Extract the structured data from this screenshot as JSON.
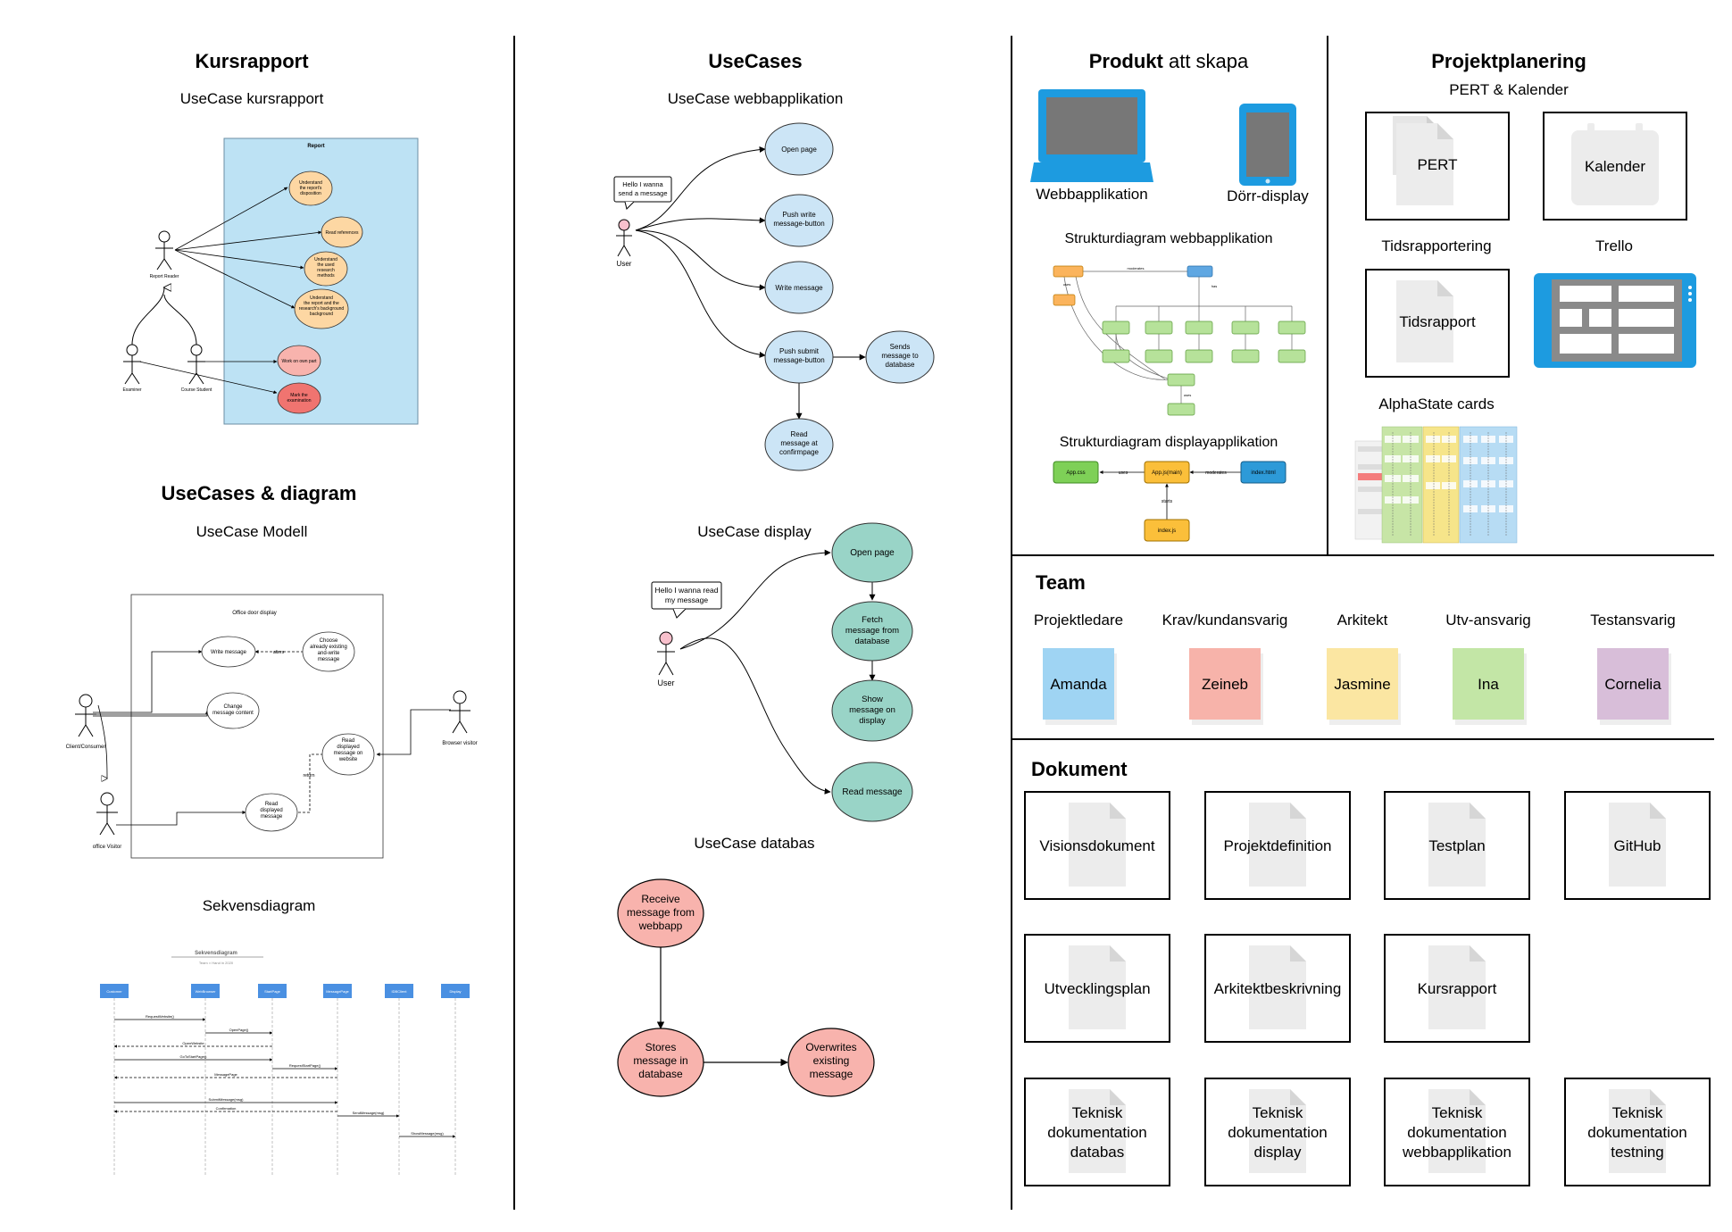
{
  "kursrapport": {
    "title": "Kursrapport",
    "subtitle": "UseCase kursrapport",
    "diagram": {
      "boundary": "Report",
      "actors": [
        "Report Reader",
        "Examiner",
        "Course Student"
      ],
      "use_cases": [
        "Understand the report's disposition",
        "Read references",
        "Understand the used research methods",
        "Understand the report and the research's background background",
        "Work on own part",
        "Mark the examination"
      ]
    }
  },
  "usecases_diagram": {
    "title": "UseCases & diagram",
    "subtitle": "UseCase Modell",
    "diagram": {
      "boundary": "Office door display",
      "actors": [
        "Client/Consumer",
        "office Visitor",
        "Browser visitor"
      ],
      "use_cases": [
        "Write message",
        "Choose already existing message",
        "Change message content",
        "Read displayed message on website",
        "Read displayed message"
      ],
      "labels": [
        "alters",
        "return"
      ]
    }
  },
  "sekvens": {
    "title": "Sekvensdiagram",
    "diagram_title": "Sekvensdiagram",
    "diagram_subtitle": "Team × Hand in 2020",
    "participants": [
      "Customer",
      "WebBrowser",
      "StartPage",
      "MessagePage",
      "IDBClient",
      "Display"
    ],
    "messages": [
      "RequestWebsite()",
      "OpenPage()",
      "OpenWebsite",
      "GoToStartPage()",
      "RequestStartPage()",
      "MessagePage",
      "SubmitMessage(msg)",
      "Confirmation",
      "SendMessage(msg)",
      "ShowMessage(msg)"
    ]
  },
  "usecases": {
    "title": "UseCases",
    "webb": {
      "subtitle": "UseCase webbapplikation",
      "speech": "Hello I wanna send a message",
      "actor": "User",
      "nodes": [
        "Open page",
        "Push write message-button",
        "Write message",
        "Push submit message-button",
        "Sends message to database",
        "Read message at confirmpage"
      ]
    },
    "display": {
      "subtitle": "UseCase display",
      "speech": "Hello I wanna read my message",
      "actor": "User",
      "nodes": [
        "Open page",
        "Fetch message from database",
        "Show message on display",
        "Read message"
      ]
    },
    "databas": {
      "subtitle": "UseCase databas",
      "nodes": [
        "Receive message from webbapp",
        "Stores message in database",
        "Overwrites existing message"
      ]
    }
  },
  "produkt": {
    "title_bold": "Produkt",
    "title_rest": " att skapa",
    "webbapp_label": "Webbapplikation",
    "display_label": "Dörr-display",
    "struktur_webb": {
      "title": "Strukturdiagram webbapplikation",
      "labels": [
        "moderates",
        "uses",
        "has",
        "uses"
      ]
    },
    "struktur_display": {
      "title": "Strukturdiagram displayapplikation",
      "nodes": [
        "App.css",
        "App.js(main)",
        "index.html",
        "index.js"
      ],
      "edges": [
        "uses",
        "moderates",
        "starts"
      ]
    }
  },
  "projektplanering": {
    "title": "Projektplanering",
    "subtitle": "PERT & Kalender",
    "cards": [
      "PERT",
      "Kalender",
      "Tidsrapport"
    ],
    "labels": [
      "Tidsrapportering",
      "Trello",
      "AlphaState cards"
    ]
  },
  "team": {
    "title": "Team",
    "members": [
      {
        "role": "Projektledare",
        "name": "Amanda",
        "color": "#9fd4f3"
      },
      {
        "role": "Krav/kundansvarig",
        "name": "Zeineb",
        "color": "#f7b3aa"
      },
      {
        "role": "Arkitekt",
        "name": "Jasmine",
        "color": "#fbe6a2"
      },
      {
        "role": "Utv-ansvarig",
        "name": "Ina",
        "color": "#c3e6a6"
      },
      {
        "role": "Testansvarig",
        "name": "Cornelia",
        "color": "#d8bed9"
      }
    ]
  },
  "dokument": {
    "title": "Dokument",
    "docs": [
      [
        "Visionsdokument"
      ],
      [
        "Projektdefinition"
      ],
      [
        "Testplan"
      ],
      [
        "GitHub"
      ],
      [
        "Utvecklingsplan"
      ],
      [
        "Arkitektbeskrivning"
      ],
      [
        "Kursrapport"
      ],
      [
        "Teknisk",
        "dokumentation",
        "databas"
      ],
      [
        "Teknisk",
        "dokumentation",
        "display"
      ],
      [
        "Teknisk",
        "dokumentation",
        "webbapplikation"
      ],
      [
        "Teknisk",
        "dokumentation",
        "testning"
      ]
    ]
  },
  "colors": {
    "blue_node": "#cce5f6",
    "teal_node": "#99d4c7",
    "red_node": "#f8b3ad",
    "orange_node": "#fdd7a3",
    "report_bg": "#bde2f4"
  }
}
